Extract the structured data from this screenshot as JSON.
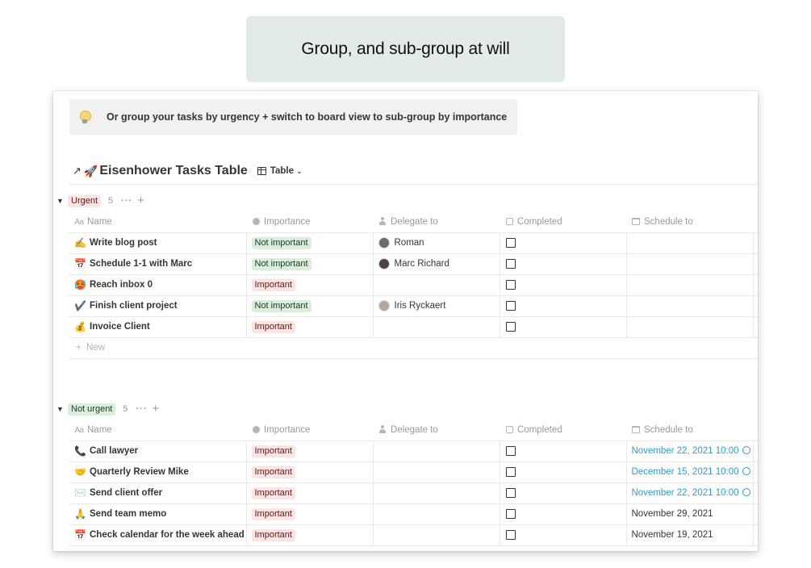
{
  "banner": {
    "text": "Group, and sub-group at will"
  },
  "callout": {
    "text": "Or group your tasks by urgency + switch to board view to sub-group by importance",
    "icon": "lightbulb-icon"
  },
  "database": {
    "arrow": "↗",
    "emoji": "🚀",
    "title": "Eisenhower Tasks Table",
    "view_label": "Table"
  },
  "columns": {
    "name": "Name",
    "importance": "Importance",
    "delegate": "Delegate to",
    "completed": "Completed",
    "schedule": "Schedule to"
  },
  "colors": {
    "red_pill_bg": "#fbe4e4",
    "green_pill_bg": "#dbeddb",
    "date_blue": "#2e9bd6"
  },
  "groups": [
    {
      "label": "Urgent",
      "color": "red",
      "count": "5",
      "new_label": "New",
      "rows": [
        {
          "emoji": "✍️",
          "name": "Write blog post",
          "importance": "Not important",
          "importance_color": "green",
          "delegate": "Roman",
          "completed": false,
          "schedule": ""
        },
        {
          "emoji": "📅",
          "name": "Schedule 1-1 with Marc",
          "importance": "Not important",
          "importance_color": "green",
          "delegate": "Marc Richard",
          "completed": false,
          "schedule": ""
        },
        {
          "emoji": "🥵",
          "name": "Reach inbox 0",
          "importance": "Important",
          "importance_color": "red",
          "delegate": "",
          "completed": false,
          "schedule": ""
        },
        {
          "emoji": "✔️",
          "name": "Finish client project",
          "importance": "Not important",
          "importance_color": "green",
          "delegate": "Iris Ryckaert",
          "completed": false,
          "schedule": ""
        },
        {
          "emoji": "💰",
          "name": "Invoice Client",
          "importance": "Important",
          "importance_color": "red",
          "delegate": "",
          "completed": false,
          "schedule": ""
        }
      ]
    },
    {
      "label": "Not urgent",
      "color": "green",
      "count": "5",
      "rows": [
        {
          "emoji": "📞",
          "name": "Call lawyer",
          "importance": "Important",
          "importance_color": "red",
          "delegate": "",
          "completed": false,
          "schedule": "November 22, 2021 10:00",
          "reminder": true
        },
        {
          "emoji": "🤝",
          "name": "Quarterly Review Mike",
          "importance": "Important",
          "importance_color": "red",
          "delegate": "",
          "completed": false,
          "schedule": "December 15, 2021 10:00",
          "reminder": true
        },
        {
          "emoji": "✉️",
          "name": "Send client offer",
          "importance": "Important",
          "importance_color": "red",
          "delegate": "",
          "completed": false,
          "schedule": "November 22, 2021 10:00",
          "reminder": true
        },
        {
          "emoji": "🙏",
          "name": "Send team memo",
          "importance": "Important",
          "importance_color": "red",
          "delegate": "",
          "completed": false,
          "schedule": "November 29, 2021",
          "reminder": false
        },
        {
          "emoji": "📅",
          "name": "Check calendar for the week ahead",
          "importance": "Important",
          "importance_color": "red",
          "delegate": "",
          "completed": false,
          "schedule": "November 19, 2021",
          "reminder": false
        }
      ]
    }
  ]
}
